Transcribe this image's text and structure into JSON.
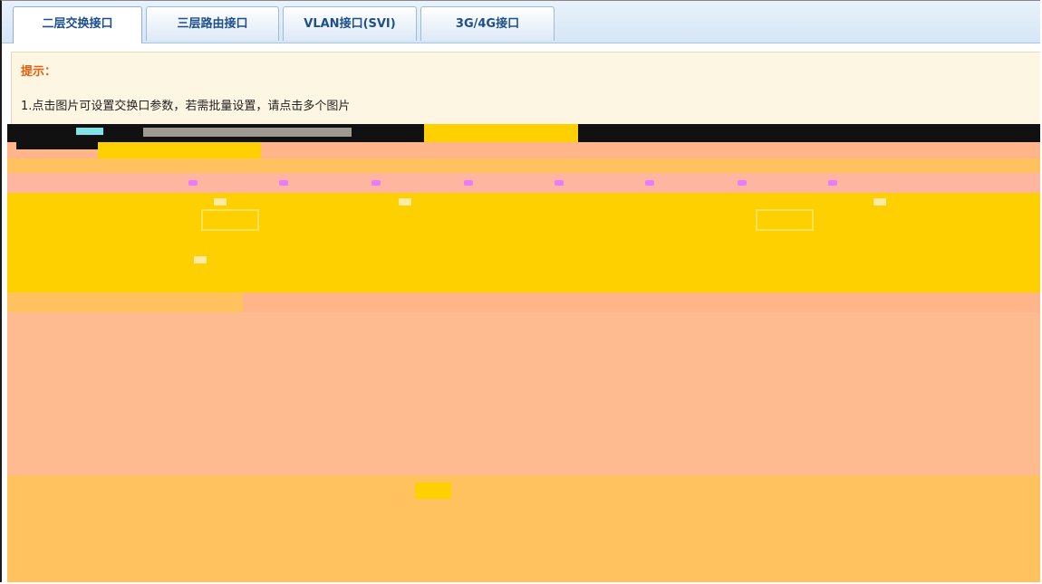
{
  "tabs": [
    {
      "label": "二层交换接口",
      "active": true
    },
    {
      "label": "三层路由接口",
      "active": false
    },
    {
      "label": "VLAN接口(SVI)",
      "active": false
    },
    {
      "label": "3G/4G接口",
      "active": false
    }
  ],
  "hint": {
    "title": "提示：",
    "line1": "1.点击图片可设置交换口参数，若需批量设置，请点击多个图片"
  },
  "colors": {
    "tab_text": "#1f4f8a",
    "hint_title": "#e0600f",
    "hint_bg": "#fdf6e3",
    "glitch_base": "#ffb48a",
    "glitch_yellow": "#ffd000"
  }
}
